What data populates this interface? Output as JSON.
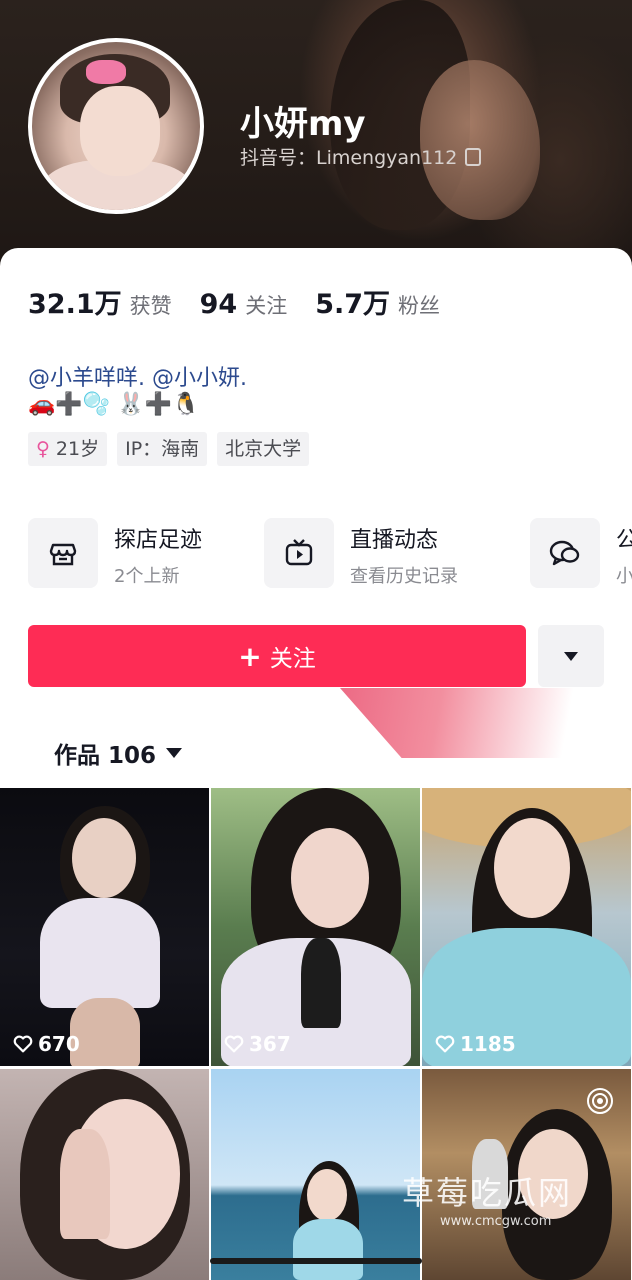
{
  "profile": {
    "nickname": "小妍my",
    "douyin_id_label": "抖音号：Limengyan112"
  },
  "stats": [
    {
      "num": "32.1万",
      "label": "获赞"
    },
    {
      "num": "94",
      "label": "关注"
    },
    {
      "num": "5.7万",
      "label": "粉丝"
    }
  ],
  "bio": {
    "mentions": "@小羊咩咩. @小小妍.",
    "emoji_line": "🚗➕🫧 🐰➕🐧"
  },
  "tags": [
    {
      "icon": "♀",
      "text": "21岁"
    },
    {
      "text": "IP：海南"
    },
    {
      "text": "北京大学"
    }
  ],
  "entries": [
    {
      "icon": "store-icon",
      "title": "探店足迹",
      "subtitle": "2个上新"
    },
    {
      "icon": "tv-icon",
      "title": "直播动态",
      "subtitle": "查看历史记录"
    },
    {
      "icon": "chat-icon",
      "title": "公",
      "subtitle": "小"
    }
  ],
  "actions": {
    "follow_label": "关注",
    "follow_plus": "+"
  },
  "works": {
    "tab_label": "作品 106"
  },
  "videos": [
    {
      "likes": "670"
    },
    {
      "likes": "367"
    },
    {
      "likes": "1185"
    },
    {
      "likes": ""
    },
    {
      "likes": ""
    },
    {
      "likes": ""
    }
  ],
  "watermark": {
    "text": "草莓吃瓜网",
    "url": "www.cmcgw.com"
  },
  "colors": {
    "accent": "#fe2c55",
    "mention": "#2c4a8e",
    "hero_bg": "#241c18"
  }
}
